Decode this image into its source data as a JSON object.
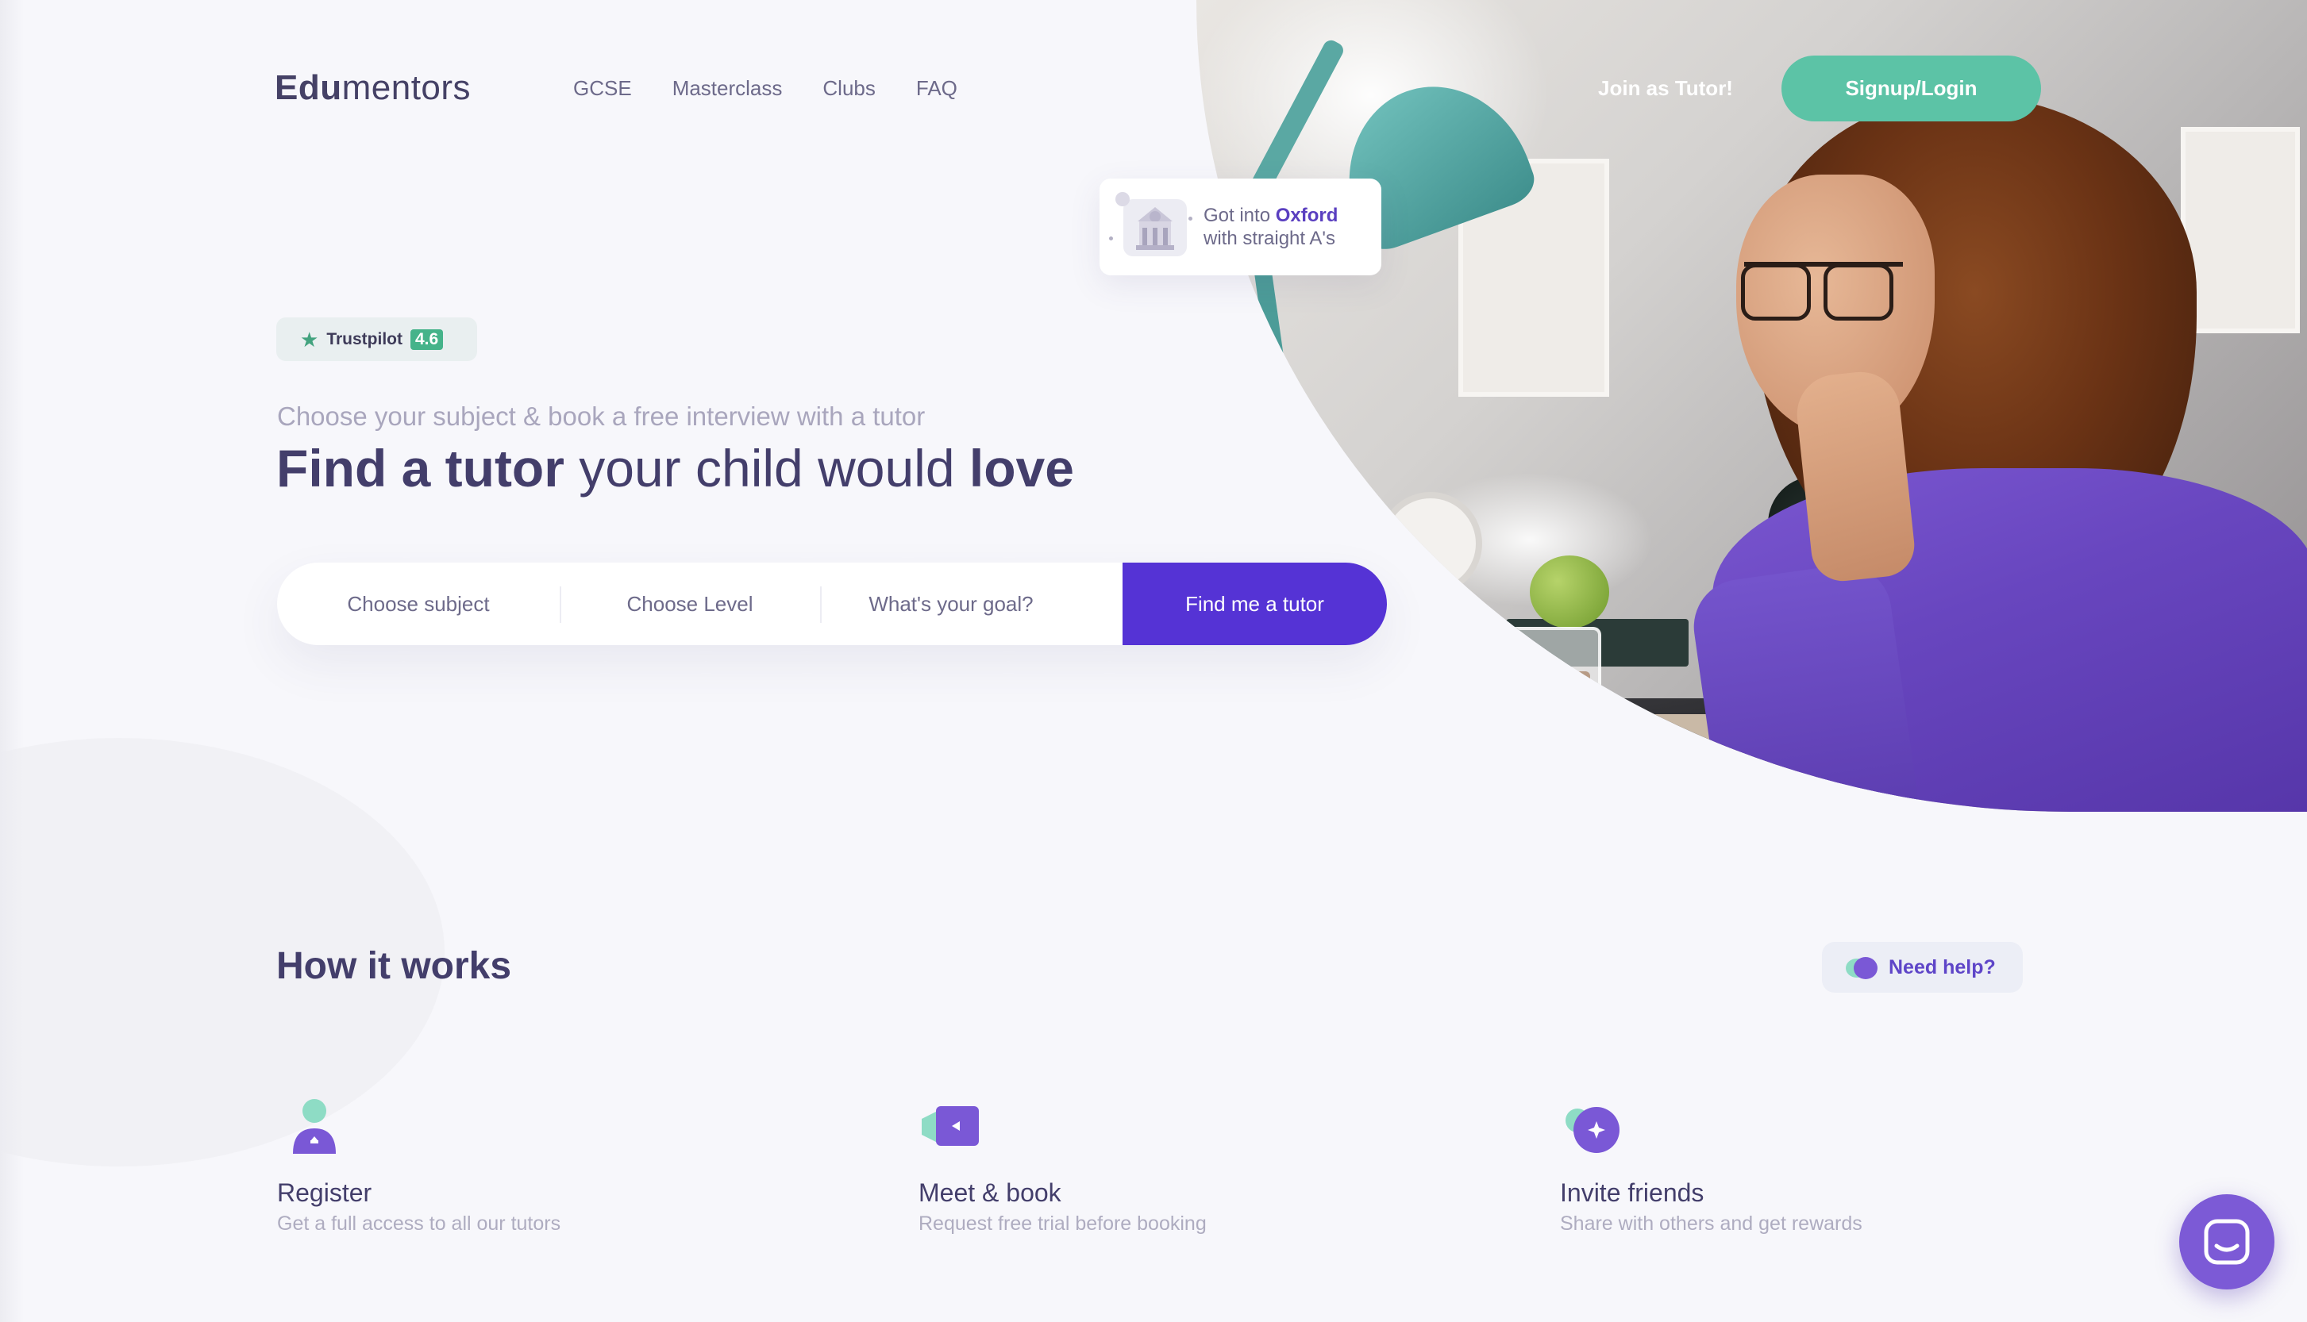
{
  "brand": {
    "logo_bold": "Edu",
    "logo_light": "mentors"
  },
  "nav": {
    "items": [
      "GCSE",
      "Masterclass",
      "Clubs",
      "FAQ"
    ],
    "join_label": "Join as Tutor!",
    "signup_label": "Signup/Login"
  },
  "badge": {
    "line1_prefix": "Got into ",
    "line1_highlight": "Oxford",
    "line2": "with straight A's"
  },
  "trustpilot": {
    "label": "Trustpilot",
    "score": "4.6"
  },
  "hero": {
    "subtitle": "Choose your subject & book a free interview with a tutor",
    "headline_bold1": "Find a tutor",
    "headline_light": " your child would ",
    "headline_bold2": "love"
  },
  "search": {
    "subject": "Choose subject",
    "level": "Choose Level",
    "goal": "What's your goal?",
    "button": "Find me a tutor"
  },
  "how": {
    "title": "How it works",
    "need_help": "Need help?",
    "steps": [
      {
        "title": "Register",
        "desc": "Get a full access to all our tutors"
      },
      {
        "title": "Meet & book",
        "desc": "Request free trial before booking"
      },
      {
        "title": "Invite friends",
        "desc": "Share with others and get rewards"
      }
    ]
  },
  "colors": {
    "primary": "#5533d5",
    "accent_green": "#5cc3a6",
    "text_dark": "#433e6b",
    "text_muted": "#a9a6bd"
  },
  "icons": [
    "star-icon",
    "building-icon",
    "user-icon",
    "video-icon",
    "invite-icon",
    "chat-bubbles-icon",
    "messenger-icon"
  ]
}
